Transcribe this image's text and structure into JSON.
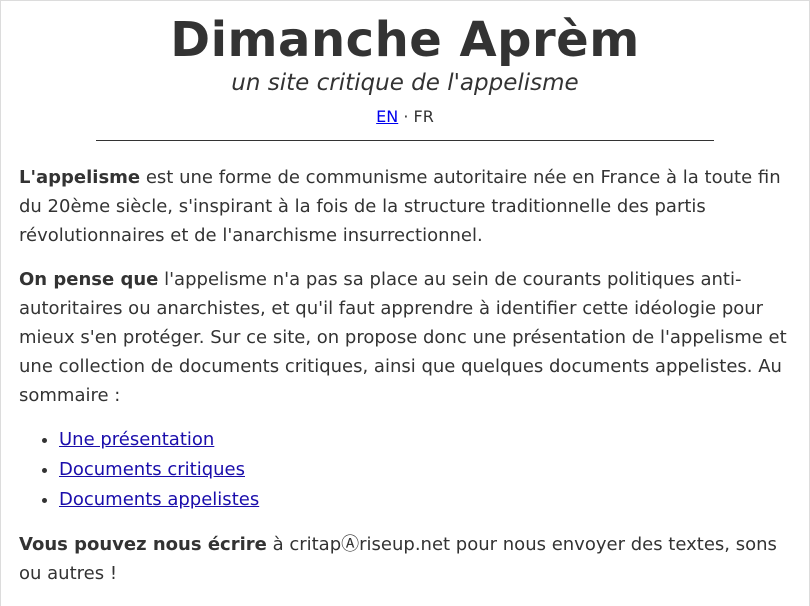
{
  "header": {
    "title": "Dimanche Aprèm",
    "subtitle": "un site critique de l'appelisme",
    "lang_en": "EN",
    "lang_sep": " · ",
    "lang_fr": "FR"
  },
  "intro": {
    "bold": "L'appelisme",
    "text": " est une forme de communisme autoritaire née en France à la toute fin du 20ème siècle, s'inspirant à la fois de la structure traditionnelle des partis révolutionnaires et de l'anarchisme insurrectionnel."
  },
  "opinion": {
    "bold": "On pense que",
    "text": " l'appelisme n'a pas sa place au sein de courants politiques anti-autoritaires ou anarchistes, et qu'il faut apprendre à identifier cette idéologie pour mieux s'en protéger. Sur ce site, on propose donc une présentation de l'appelisme et une collection de documents critiques, ainsi que quelques documents appelistes. Au sommaire :"
  },
  "toc": [
    {
      "label": "Une présentation"
    },
    {
      "label": "Documents critiques"
    },
    {
      "label": "Documents appelistes"
    }
  ],
  "contact": {
    "bold": "Vous pouvez nous écrire",
    "text": " à critapⒶriseup.net pour nous envoyer des textes, sons ou autres !"
  },
  "colors": {
    "text": "#333333",
    "link": "#1a0dab"
  }
}
